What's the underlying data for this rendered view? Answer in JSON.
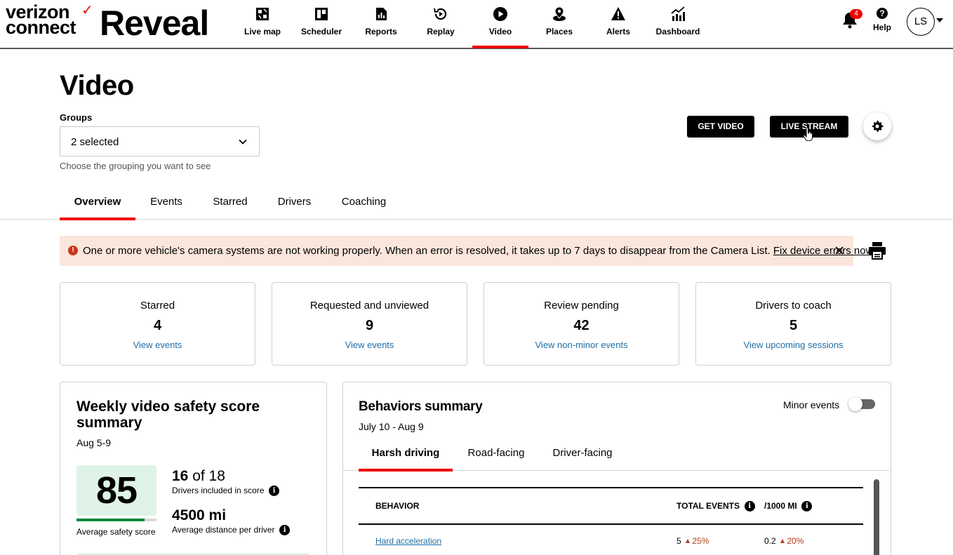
{
  "brand": {
    "company_line1": "verizon",
    "company_line2": "connect",
    "product": "Reveal",
    "accent_color": "#ee0000"
  },
  "nav": {
    "items": [
      {
        "label": "Live map",
        "icon": "map-icon"
      },
      {
        "label": "Scheduler",
        "icon": "scheduler-icon"
      },
      {
        "label": "Reports",
        "icon": "reports-icon"
      },
      {
        "label": "Replay",
        "icon": "replay-icon"
      },
      {
        "label": "Video",
        "icon": "play-icon",
        "active": true
      },
      {
        "label": "Places",
        "icon": "places-icon"
      },
      {
        "label": "Alerts",
        "icon": "alert-icon"
      },
      {
        "label": "Dashboard",
        "icon": "dashboard-icon"
      }
    ],
    "notifications_count": "4",
    "help_label": "Help",
    "user_initials": "LS"
  },
  "page": {
    "title": "Video",
    "groups_label": "Groups",
    "groups_value": "2 selected",
    "groups_help": "Choose the grouping you want to see",
    "get_video_label": "GET VIDEO",
    "live_stream_label": "LIVE STREAM"
  },
  "tabs": [
    {
      "label": "Overview",
      "active": true
    },
    {
      "label": "Events"
    },
    {
      "label": "Starred"
    },
    {
      "label": "Drivers"
    },
    {
      "label": "Coaching"
    }
  ],
  "alert": {
    "message": "One or more vehicle's camera systems are not working properly. When an error is resolved, it takes up to 7 days to disappear from the Camera List.",
    "link": "Fix device errors now."
  },
  "stats": [
    {
      "label": "Starred",
      "value": "4",
      "link": "View events"
    },
    {
      "label": "Requested and unviewed",
      "value": "9",
      "link": "View events"
    },
    {
      "label": "Review pending",
      "value": "42",
      "link": "View non-minor events"
    },
    {
      "label": "Drivers to coach",
      "value": "5",
      "link": "View upcoming sessions"
    }
  ],
  "weekly": {
    "title": "Weekly video safety score summary",
    "date": "Aug 5-9",
    "score": "85",
    "score_fraction": 0.85,
    "score_label": "Average safety score",
    "drivers_included": "16",
    "drivers_of": "of 18",
    "drivers_label": "Drivers included in score",
    "distance": "4500 mi",
    "distance_label": "Average distance per driver"
  },
  "behaviors": {
    "title": "Behaviors summary",
    "date": "July 10 - Aug 9",
    "minor_label": "Minor events",
    "tabs": [
      {
        "label": "Harsh driving",
        "active": true
      },
      {
        "label": "Road-facing"
      },
      {
        "label": "Driver-facing"
      }
    ],
    "columns": {
      "behavior": "BEHAVIOR",
      "total": "TOTAL EVENTS",
      "per": "/1000 MI"
    },
    "rows": [
      {
        "behavior": "Hard acceleration",
        "total": "5",
        "total_change": "25%",
        "per": "0.2",
        "per_change": "20%"
      }
    ]
  }
}
